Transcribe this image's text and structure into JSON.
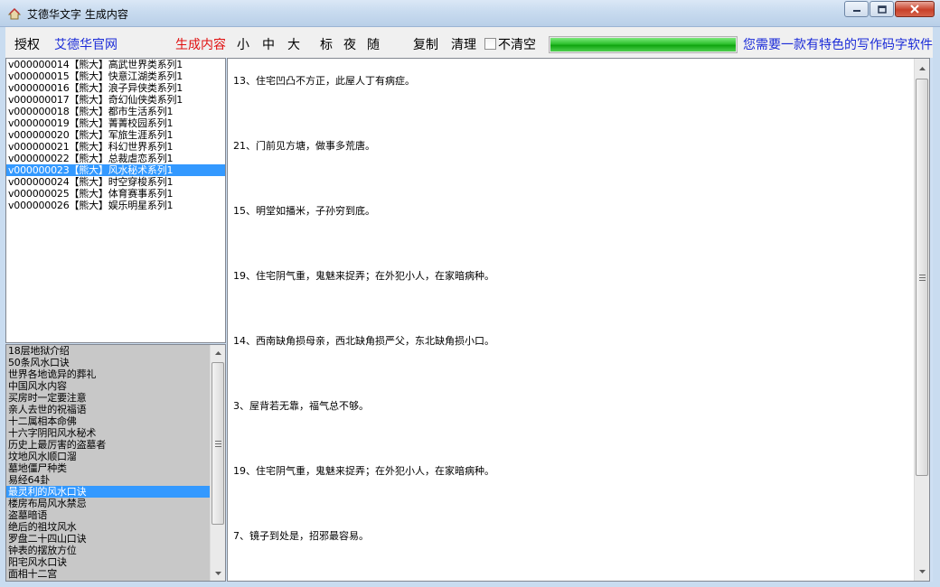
{
  "window": {
    "title": "艾德华文字 生成内容"
  },
  "toolbar": {
    "auth": "授权",
    "official_site": "艾德华官网",
    "generate": "生成内容",
    "size_small": "小",
    "size_medium": "中",
    "size_large": "大",
    "mode_standard": "标",
    "mode_night": "夜",
    "mode_random": "随",
    "copy": "复制",
    "clear": "清理",
    "no_clear": "不清空",
    "no_clear_checked": false,
    "progress_fraction": 1.0,
    "promo": "您需要一款有特色的写作码字软件"
  },
  "category_list": {
    "selected_index": 9,
    "items": [
      "v000000014【熊大】高武世界类系列1",
      "v000000015【熊大】快意江湖类系列1",
      "v000000016【熊大】浪子异侠类系列1",
      "v000000017【熊大】奇幻仙侠类系列1",
      "v000000018【熊大】都市生活系列1",
      "v000000019【熊大】菁菁校园系列1",
      "v000000020【熊大】军旅生涯系列1",
      "v000000021【熊大】科幻世界系列1",
      "v000000022【熊大】总裁虐恋系列1",
      "v000000023【熊大】风水秘术系列1",
      "v000000024【熊大】时空穿梭系列1",
      "v000000025【熊大】体育赛事系列1",
      "v000000026【熊大】娱乐明星系列1"
    ]
  },
  "topic_list": {
    "selected_index": 12,
    "items": [
      "18层地狱介绍",
      "50条风水口诀",
      "世界各地诡异的葬礼",
      "中国风水内容",
      "买房时一定要注意",
      "亲人去世的祝福语",
      "十二属相本命佛",
      "十六字阴阳风水秘术",
      "历史上最厉害的盗墓者",
      "坟地风水顺口溜",
      "墓地僵尸种类",
      "易经64卦",
      "最灵利的风水口诀",
      "楼房布局风水禁忌",
      "盗墓暗语",
      "绝后的祖坟风水",
      "罗盘二十四山口诀",
      "钟表的摆放方位",
      "阳宅风水口诀",
      "面相十二宫"
    ]
  },
  "content": {
    "lines": [
      "13、住宅凹凸不方正，此屋人丁有病症。",
      "21、门前见方塘，做事多荒唐。",
      "15、明堂如播米，子孙穷到底。",
      "19、住宅阴气重，鬼魅来捉弄；在外犯小人，在家暗病种。",
      "14、西南缺角损母亲，西北缺角损严父，东北缺角损小口。",
      "3、屋背若无靠，福气总不够。",
      "19、住宅阴气重，鬼魅来捉弄；在外犯小人，在家暗病种。",
      "7、镜子到处是，招邪最容易。"
    ]
  }
}
